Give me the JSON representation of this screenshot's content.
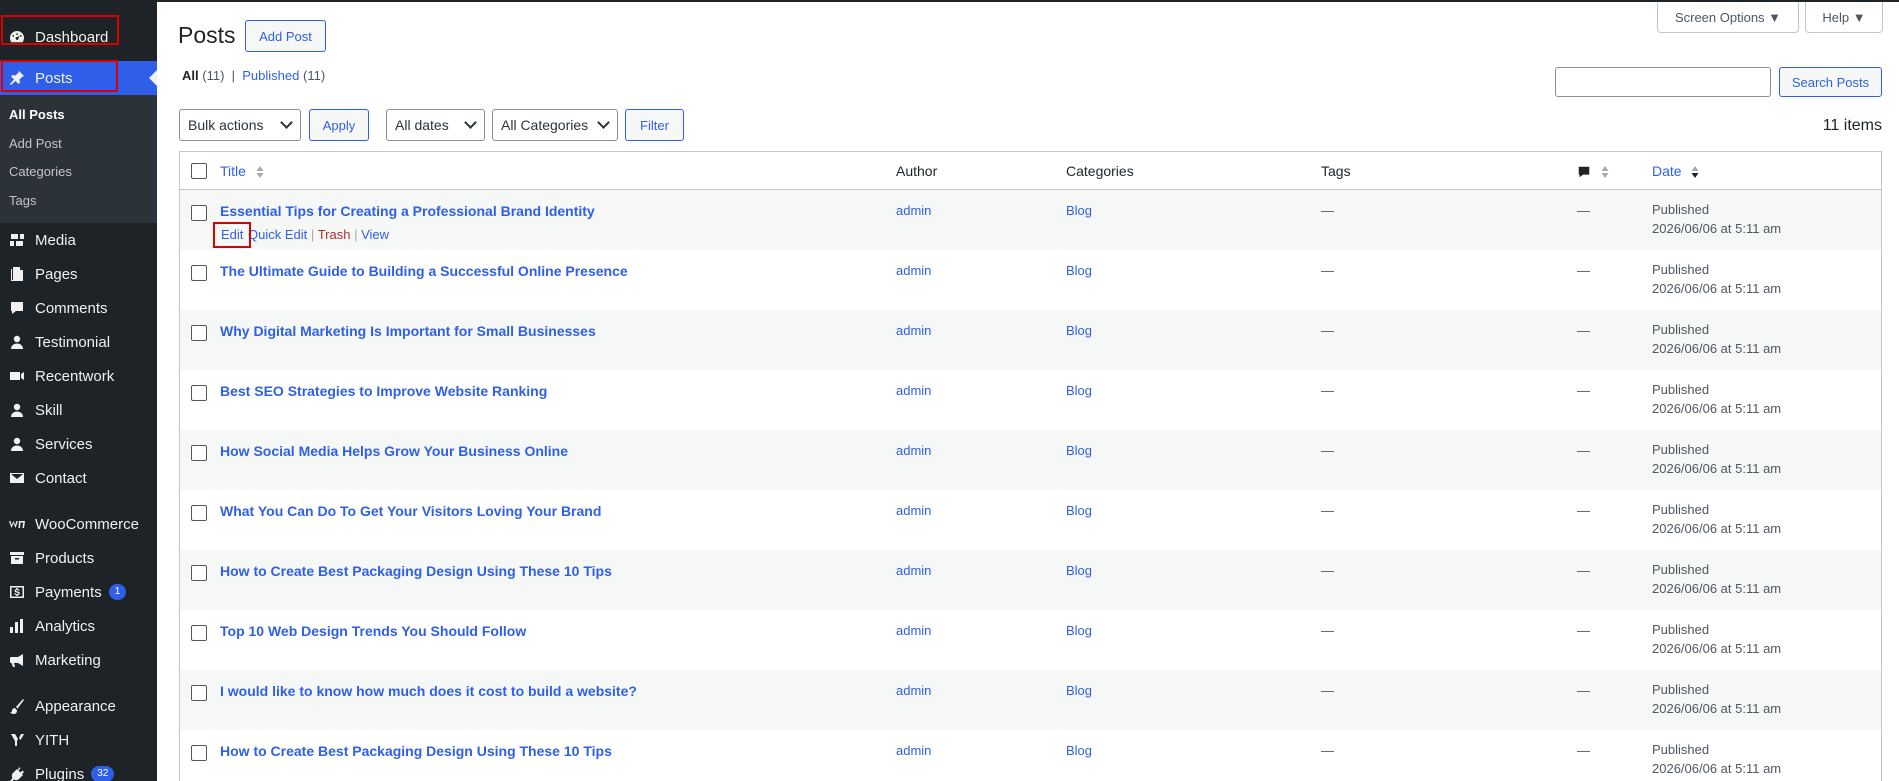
{
  "sidebar": {
    "items": [
      {
        "label": "Dashboard",
        "icon": "dashboard-icon"
      },
      {
        "label": "Posts",
        "icon": "pin-icon"
      },
      {
        "label": "Media",
        "icon": "media-icon"
      },
      {
        "label": "Pages",
        "icon": "pages-icon"
      },
      {
        "label": "Comments",
        "icon": "comment-icon"
      },
      {
        "label": "Testimonial",
        "icon": "person-icon"
      },
      {
        "label": "Recentwork",
        "icon": "video-icon"
      },
      {
        "label": "Skill",
        "icon": "person-icon"
      },
      {
        "label": "Services",
        "icon": "person-icon"
      },
      {
        "label": "Contact",
        "icon": "envelope-icon"
      },
      {
        "label": "WooCommerce",
        "icon": "woo-icon"
      },
      {
        "label": "Products",
        "icon": "archive-icon"
      },
      {
        "label": "Payments",
        "icon": "dollar-icon",
        "badge": "1"
      },
      {
        "label": "Analytics",
        "icon": "bar-chart-icon"
      },
      {
        "label": "Marketing",
        "icon": "megaphone-icon"
      },
      {
        "label": "Appearance",
        "icon": "brush-icon"
      },
      {
        "label": "YITH",
        "icon": "yith-icon"
      },
      {
        "label": "Plugins",
        "icon": "plug-icon",
        "badge": "32"
      }
    ],
    "submenu": [
      "All Posts",
      "Add Post",
      "Categories",
      "Tags"
    ]
  },
  "header": {
    "title": "Posts",
    "add_post": "Add Post",
    "screen_options": "Screen Options ▼",
    "help": "Help ▼"
  },
  "filters": {
    "all_label": "All",
    "all_count": "(11)",
    "separator": "|",
    "published_label": "Published",
    "published_count": "(11)",
    "bulk_actions": "Bulk actions",
    "apply": "Apply",
    "all_dates": "All dates",
    "all_categories": "All Categories",
    "filter": "Filter",
    "search_button": "Search Posts",
    "search_value": "",
    "items_count": "11 items"
  },
  "table": {
    "headers": {
      "title": "Title",
      "author": "Author",
      "categories": "Categories",
      "tags": "Tags",
      "date": "Date"
    },
    "row_actions": {
      "edit": "Edit",
      "quick_edit": "Quick Edit",
      "trash": "Trash",
      "view": "View",
      "sep": "|"
    },
    "rows": [
      {
        "title": "Essential Tips for Creating a Professional Brand Identity",
        "author": "admin",
        "category": "Blog",
        "tags": "—",
        "comments": "—",
        "status": "Published",
        "date": "2026/06/06 at 5:11 am"
      },
      {
        "title": "The Ultimate Guide to Building a Successful Online Presence",
        "author": "admin",
        "category": "Blog",
        "tags": "—",
        "comments": "—",
        "status": "Published",
        "date": "2026/06/06 at 5:11 am"
      },
      {
        "title": "Why Digital Marketing Is Important for Small Businesses",
        "author": "admin",
        "category": "Blog",
        "tags": "—",
        "comments": "—",
        "status": "Published",
        "date": "2026/06/06 at 5:11 am"
      },
      {
        "title": "Best SEO Strategies to Improve Website Ranking",
        "author": "admin",
        "category": "Blog",
        "tags": "—",
        "comments": "—",
        "status": "Published",
        "date": "2026/06/06 at 5:11 am"
      },
      {
        "title": "How Social Media Helps Grow Your Business Online",
        "author": "admin",
        "category": "Blog",
        "tags": "—",
        "comments": "—",
        "status": "Published",
        "date": "2026/06/06 at 5:11 am"
      },
      {
        "title": "What You Can Do To Get Your Visitors Loving Your Brand",
        "author": "admin",
        "category": "Blog",
        "tags": "—",
        "comments": "—",
        "status": "Published",
        "date": "2026/06/06 at 5:11 am"
      },
      {
        "title": "How to Create Best Packaging Design Using These 10 Tips",
        "author": "admin",
        "category": "Blog",
        "tags": "—",
        "comments": "—",
        "status": "Published",
        "date": "2026/06/06 at 5:11 am"
      },
      {
        "title": "Top 10 Web Design Trends You Should Follow",
        "author": "admin",
        "category": "Blog",
        "tags": "—",
        "comments": "—",
        "status": "Published",
        "date": "2026/06/06 at 5:11 am"
      },
      {
        "title": "I would like to know how much does it cost to build a website?",
        "author": "admin",
        "category": "Blog",
        "tags": "—",
        "comments": "—",
        "status": "Published",
        "date": "2026/06/06 at 5:11 am"
      },
      {
        "title": "How to Create Best Packaging Design Using These 10 Tips",
        "author": "admin",
        "category": "Blog",
        "tags": "—",
        "comments": "—",
        "status": "Published",
        "date": "2026/06/06 at 5:11 am"
      }
    ]
  },
  "colors": {
    "accent": "#2f5fe8",
    "sidebar_bg": "#1d2327",
    "highlight_box": "#dd0000"
  }
}
